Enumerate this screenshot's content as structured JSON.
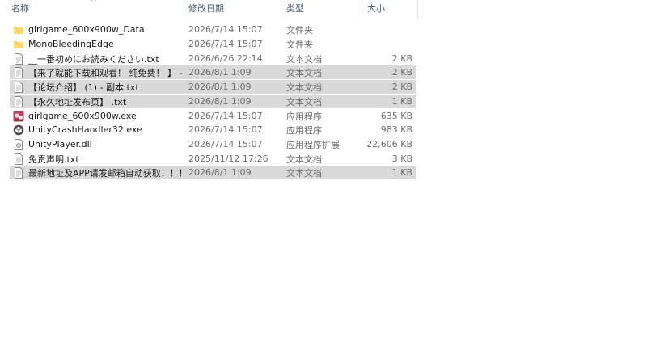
{
  "header": {
    "name": "名称",
    "date": "修改日期",
    "type": "类型",
    "size": "大小",
    "sort_arrow": "^"
  },
  "files": [
    {
      "name": "girlgame_600x900w_Data",
      "date": "2026/7/14 15:07",
      "type": "文件夹",
      "size": "",
      "icon": "folder-icon",
      "selected": false
    },
    {
      "name": "MonoBleedingEdge",
      "date": "2026/7/14 15:07",
      "type": "文件夹",
      "size": "",
      "icon": "folder-icon",
      "selected": false
    },
    {
      "name": "__一番初めにお読みください.txt",
      "date": "2026/6/26 22:14",
      "type": "文本文档",
      "size": "2 KB",
      "icon": "text-file-icon",
      "selected": false
    },
    {
      "name": "【来了就能下载和观看！ 纯免费！ 】 - 副...",
      "date": "2026/8/1 1:09",
      "type": "文本文档",
      "size": "2 KB",
      "icon": "text-file-icon",
      "selected": true
    },
    {
      "name": "【论坛介绍】 (1) - 副本.txt",
      "date": "2026/8/1 1:09",
      "type": "文本文档",
      "size": "2 KB",
      "icon": "text-file-icon",
      "selected": true
    },
    {
      "name": "【永久地址发布页】 .txt",
      "date": "2026/8/1 1:09",
      "type": "文本文档",
      "size": "1 KB",
      "icon": "text-file-icon",
      "selected": true
    },
    {
      "name": "girlgame_600x900w.exe",
      "date": "2026/7/14 15:07",
      "type": "应用程序",
      "size": "635 KB",
      "icon": "game-exe-icon",
      "selected": false
    },
    {
      "name": "UnityCrashHandler32.exe",
      "date": "2026/7/14 15:07",
      "type": "应用程序",
      "size": "983 KB",
      "icon": "unity-exe-icon",
      "selected": false
    },
    {
      "name": "UnityPlayer.dll",
      "date": "2026/7/14 15:07",
      "type": "应用程序扩展",
      "size": "22,606 KB",
      "icon": "dll-file-icon",
      "selected": false
    },
    {
      "name": "免责声明.txt",
      "date": "2025/11/12 17:26",
      "type": "文本文档",
      "size": "3 KB",
      "icon": "text-file-icon",
      "selected": false
    },
    {
      "name": "最新地址及APP请发邮箱自动获取！！！...",
      "date": "2026/8/1 1:09",
      "type": "文本文档",
      "size": "1 KB",
      "icon": "text-file-icon",
      "selected": true
    }
  ]
}
